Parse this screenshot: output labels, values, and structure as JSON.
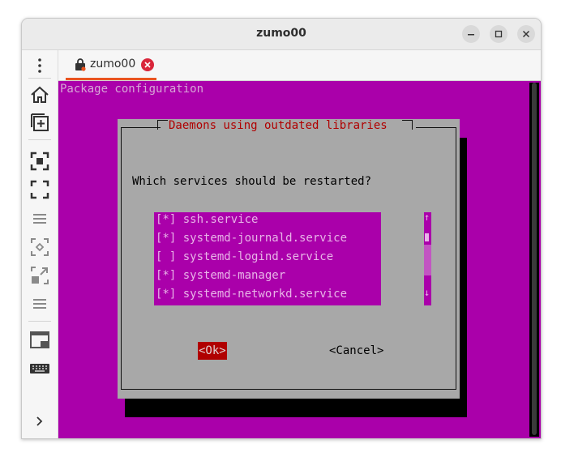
{
  "window": {
    "title": "zumo00"
  },
  "tab": {
    "label": "zumo00"
  },
  "sidebar": {
    "icons": [
      "more-vertical-icon",
      "home-icon",
      "add-box-icon",
      "focus-frame-icon",
      "fullscreen-icon",
      "menu-lines-icon",
      "select-area-icon",
      "window-pip-icon",
      "menu-lines-icon",
      "window-icon",
      "keyboard-icon",
      "chevron-right-icon"
    ]
  },
  "terminal": {
    "header": "Package configuration",
    "dialog": {
      "title": "Daemons using outdated libraries",
      "question": "Which services should be restarted?",
      "items": [
        "[*] ssh.service",
        "[*] systemd-journald.service",
        "[ ] systemd-logind.service",
        "[*] systemd-manager",
        "[*] systemd-networkd.service"
      ],
      "scroll_up": "↑",
      "scroll_down": "↓",
      "ok_label": "<Ok>",
      "cancel_label": "<Cancel>"
    }
  },
  "colors": {
    "terminal_bg": "#aa00aa",
    "dialog_bg": "#a8a8a8",
    "accent": "#e95420",
    "ok_bg": "#b00000",
    "title_text": "#b00000"
  }
}
